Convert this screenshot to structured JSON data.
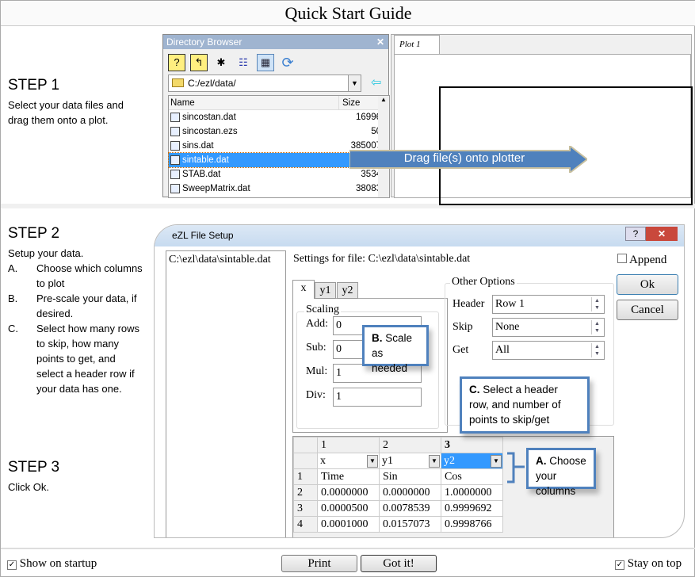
{
  "title": "Quick Start Guide",
  "step1": {
    "heading": "STEP 1",
    "text": "Select your data files and drag them onto a plot."
  },
  "step2": {
    "heading": "STEP 2",
    "intro": "Setup your data.",
    "items": [
      {
        "letter": "A.",
        "text": "Choose which columns to plot"
      },
      {
        "letter": "B.",
        "text": "Pre-scale your data, if desired."
      },
      {
        "letter": "C.",
        "text": "Select how many rows to skip, how many points to get, and select a header row if your data has one."
      }
    ]
  },
  "step3": {
    "heading": "STEP 3",
    "text": "Click Ok."
  },
  "dir_browser": {
    "title": "Directory Browser",
    "path": "C:/ezl/data/",
    "col_name": "Name",
    "col_size": "Size",
    "files": [
      {
        "name": "sincostan.dat",
        "size": "16996"
      },
      {
        "name": "sincostan.ezs",
        "size": "50"
      },
      {
        "name": "sins.dat",
        "size": "385007"
      },
      {
        "name": "sintable.dat",
        "size": "",
        "selected": true
      },
      {
        "name": "STAB.dat",
        "size": "3534"
      },
      {
        "name": "SweepMatrix.dat",
        "size": "38083"
      }
    ],
    "toolbar_icons": [
      "help-folder-icon",
      "up-folder-icon",
      "new-folder-icon",
      "list-view-icon",
      "details-view-icon",
      "refresh-icon"
    ]
  },
  "plot_tab": "Plot 1",
  "drag_label": "Drag file(s) onto plotter",
  "file_setup": {
    "title": "eZL File Setup",
    "file_list": [
      "C:\\ezl\\data\\sintable.dat"
    ],
    "settings_label": "Settings for file: C:\\ezl\\data\\sintable.dat",
    "tabs": [
      "x",
      "y1",
      "y2"
    ],
    "active_tab": "x",
    "scaling_label": "Scaling",
    "scaling": [
      {
        "label": "Add:",
        "value": "0"
      },
      {
        "label": "Sub:",
        "value": "0"
      },
      {
        "label": "Mul:",
        "value": "1"
      },
      {
        "label": "Div:",
        "value": "1"
      }
    ],
    "other_options_label": "Other Options",
    "options": [
      {
        "label": "Header",
        "value": "Row 1"
      },
      {
        "label": "Skip",
        "value": "None"
      },
      {
        "label": "Get",
        "value": "All"
      }
    ],
    "append_label": "Append",
    "ok_label": "Ok",
    "cancel_label": "Cancel",
    "grid": {
      "col_numbers": [
        "1",
        "2",
        "3"
      ],
      "col_assign": [
        "x",
        "y1",
        "y2"
      ],
      "rows": [
        [
          "1",
          "Time",
          "Sin",
          "Cos"
        ],
        [
          "2",
          "0.0000000",
          "0.0000000",
          "1.0000000"
        ],
        [
          "3",
          "0.0000500",
          "0.0078539",
          "0.9999692"
        ],
        [
          "4",
          "0.0001000",
          "0.0157073",
          "0.9998766"
        ]
      ]
    }
  },
  "callouts": {
    "b_letter": "B.",
    "b_text": " Scale as needed",
    "c_letter": "C.",
    "c_text": " Select a header row, and number of points to skip/get",
    "a_letter": "A.",
    "a_text": " Choose your columns"
  },
  "footer": {
    "show_on_startup": "Show on startup",
    "print": "Print",
    "got_it": "Got it!",
    "stay_on_top": "Stay on top"
  },
  "colors": {
    "accent": "#4f81bd",
    "selection": "#3399ff"
  }
}
